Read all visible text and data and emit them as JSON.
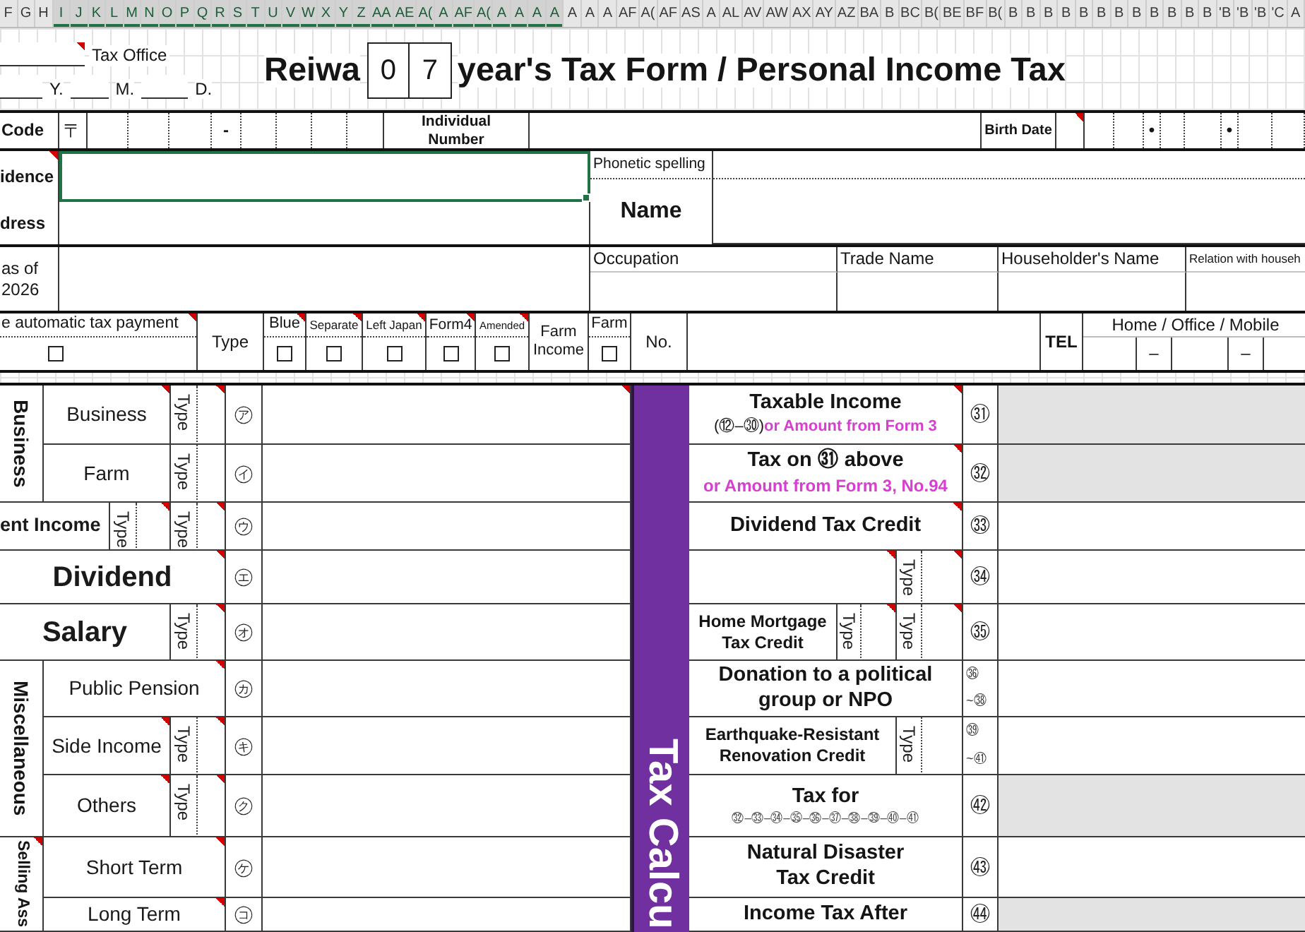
{
  "column_headers": [
    {
      "label": "F",
      "selected": false
    },
    {
      "label": "G",
      "selected": false
    },
    {
      "label": "H",
      "selected": false
    },
    {
      "label": "I",
      "selected": true
    },
    {
      "label": "J",
      "selected": true
    },
    {
      "label": "K",
      "selected": true
    },
    {
      "label": "L",
      "selected": true
    },
    {
      "label": "M",
      "selected": true
    },
    {
      "label": "N",
      "selected": true
    },
    {
      "label": "O",
      "selected": true
    },
    {
      "label": "P",
      "selected": true
    },
    {
      "label": "Q",
      "selected": true
    },
    {
      "label": "R",
      "selected": true
    },
    {
      "label": "S",
      "selected": true
    },
    {
      "label": "T",
      "selected": true
    },
    {
      "label": "U",
      "selected": true
    },
    {
      "label": "V",
      "selected": true
    },
    {
      "label": "W",
      "selected": true
    },
    {
      "label": "X",
      "selected": true
    },
    {
      "label": "Y",
      "selected": true
    },
    {
      "label": "Z",
      "selected": true
    },
    {
      "label": "AA",
      "selected": true
    },
    {
      "label": "AE",
      "selected": true
    },
    {
      "label": "A(",
      "selected": true
    },
    {
      "label": "A",
      "selected": true
    },
    {
      "label": "AF",
      "selected": true
    },
    {
      "label": "A(",
      "selected": true
    },
    {
      "label": "A",
      "selected": true
    },
    {
      "label": "A",
      "selected": true
    },
    {
      "label": "A",
      "selected": true
    },
    {
      "label": "A",
      "selected": true
    },
    {
      "label": "A",
      "selected": false
    },
    {
      "label": "A",
      "selected": false
    },
    {
      "label": "A",
      "selected": false
    },
    {
      "label": "AF",
      "selected": false
    },
    {
      "label": "A(",
      "selected": false
    },
    {
      "label": "AF",
      "selected": false
    },
    {
      "label": "AS",
      "selected": false
    },
    {
      "label": "A",
      "selected": false
    },
    {
      "label": "AL",
      "selected": false
    },
    {
      "label": "AV",
      "selected": false
    },
    {
      "label": "AW",
      "selected": false
    },
    {
      "label": "AX",
      "selected": false
    },
    {
      "label": "AY",
      "selected": false
    },
    {
      "label": "AZ",
      "selected": false
    },
    {
      "label": "BA",
      "selected": false
    },
    {
      "label": "B",
      "selected": false
    },
    {
      "label": "BC",
      "selected": false
    },
    {
      "label": "B(",
      "selected": false
    },
    {
      "label": "BE",
      "selected": false
    },
    {
      "label": "BF",
      "selected": false
    },
    {
      "label": "B(",
      "selected": false
    },
    {
      "label": "B",
      "selected": false
    },
    {
      "label": "B",
      "selected": false
    },
    {
      "label": "B",
      "selected": false
    },
    {
      "label": "B",
      "selected": false
    },
    {
      "label": "B",
      "selected": false
    },
    {
      "label": "B",
      "selected": false
    },
    {
      "label": "B",
      "selected": false
    },
    {
      "label": "B",
      "selected": false
    },
    {
      "label": "B",
      "selected": false
    },
    {
      "label": "B",
      "selected": false
    },
    {
      "label": "B",
      "selected": false
    },
    {
      "label": "B",
      "selected": false
    },
    {
      "label": "'B",
      "selected": false
    },
    {
      "label": "'B",
      "selected": false
    },
    {
      "label": "'B",
      "selected": false
    },
    {
      "label": "'C",
      "selected": false
    },
    {
      "label": "A",
      "selected": false
    }
  ],
  "top": {
    "office": {
      "label": "Tax Office",
      "note": true
    },
    "date_parts": [
      "Y.",
      "M.",
      "D."
    ],
    "title_start": "Reiwa",
    "year_digits": [
      "0",
      "7"
    ],
    "title_end": "year's Tax Form / Personal Income Tax"
  },
  "code_row": {
    "label": "Code",
    "postal_mark": "〒",
    "postal_dash": "-",
    "number_label": "Individual Number",
    "birth_label": "Birth Date",
    "birth_note": true,
    "birth_dots": [
      "•",
      "•"
    ]
  },
  "residence": {
    "labels": [
      "idence",
      "dress"
    ],
    "label_note": true,
    "field_selected": true,
    "phonetic_label": "Phonetic spelling",
    "name_label": "Name"
  },
  "as_of": {
    "lines": [
      "as of",
      "2026"
    ],
    "fields": [
      "Occupation",
      "Trade Name",
      "Householder's Name",
      "Relation with househ"
    ]
  },
  "options": {
    "auto_payment": {
      "label": "e automatic tax payment",
      "checked": false,
      "note": true
    },
    "type_label": "Type",
    "flags": [
      {
        "label": "Blue",
        "checked": false,
        "note": true
      },
      {
        "label": "Separate",
        "checked": false,
        "note": true
      },
      {
        "label": "Left Japan",
        "checked": false,
        "note": true
      },
      {
        "label": "Form4",
        "checked": false,
        "note": true
      },
      {
        "label": "Amended",
        "checked": false,
        "note": true
      }
    ],
    "farm_income_label": "Farm Income",
    "farm": {
      "label": "Farm",
      "checked": false,
      "note": false
    },
    "number_label": "No.",
    "tel_label": "TEL",
    "phone_label": "Home / Office / Mobile",
    "phone_dashes": [
      "–",
      "–"
    ]
  },
  "income": [
    {
      "kind": "group",
      "label": "Business",
      "note": false,
      "rows": [
        {
          "label": "Business",
          "note": true,
          "types": [
            {
              "label": "Type",
              "note": true
            }
          ],
          "mark": "㋐",
          "value_note": true
        },
        {
          "label": "Farm",
          "note": false,
          "types": [
            {
              "label": "Type",
              "note": false
            }
          ],
          "mark": "㋑",
          "value_note": false
        }
      ]
    },
    {
      "kind": "row",
      "label": "ent Income",
      "note": false,
      "types": [
        {
          "label": "Type",
          "note": true
        },
        {
          "label": "Type",
          "note": true
        }
      ],
      "mark": "㋒",
      "value_note": false
    },
    {
      "kind": "row",
      "label": "Dividend",
      "note": true,
      "mark": "㋓",
      "value_note": false
    },
    {
      "kind": "row",
      "label": "Salary",
      "note": false,
      "types": [
        {
          "label": "Type",
          "note": true
        }
      ],
      "mark": "㋔",
      "value_note": false
    },
    {
      "kind": "group",
      "label": "Miscellaneous",
      "note": false,
      "rows": [
        {
          "label": "Public Pension",
          "note": true,
          "mark": "㋕",
          "value_note": false
        },
        {
          "label": "Side Income",
          "note": true,
          "types": [
            {
              "label": "Type",
              "note": true
            }
          ],
          "mark": "㋖",
          "value_note": false
        },
        {
          "label": "Others",
          "note": true,
          "types": [
            {
              "label": "Type",
              "note": true
            }
          ],
          "mark": "㋗",
          "value_note": false
        }
      ]
    },
    {
      "kind": "group",
      "label": "Selling Ass",
      "note": true,
      "rows": [
        {
          "label": "Short Term",
          "note": true,
          "mark": "㋘",
          "value_note": false
        },
        {
          "label": "Long Term",
          "note": true,
          "mark": "㋙",
          "value_note": false
        }
      ]
    }
  ],
  "band": {
    "label": "Tax Calcu"
  },
  "tax_rows": [
    {
      "title": "Taxable Income",
      "formula": "(⑫–㉚)",
      "alt": "or Amount from Form 3",
      "title_note": true,
      "marks": [
        "㉛"
      ],
      "shaded": true
    },
    {
      "title": "Tax on ㉛ above",
      "alt": "or Amount from Form 3, No.94",
      "title_note": true,
      "marks": [
        "㉜"
      ],
      "shaded": true
    },
    {
      "title": "Dividend Tax Credit",
      "title_note": true,
      "marks": [
        "㉝"
      ],
      "shaded": false
    },
    {
      "title_note": true,
      "types": [
        {
          "label": "Type",
          "note": true
        }
      ],
      "marks": [
        "㉞"
      ],
      "shaded": false
    },
    {
      "title": "Home Mortgage Tax Credit",
      "title_note": false,
      "types": [
        {
          "label": "Type",
          "note": true
        },
        {
          "label": "Type",
          "note": true
        }
      ],
      "marks": [
        "㉟"
      ],
      "shaded": false
    },
    {
      "title": "Donation to a political group or NPO",
      "title_note": false,
      "marks": [
        "㊱",
        "~㊳"
      ],
      "shaded": false
    },
    {
      "title": "Earthquake-Resistant Renovation Credit",
      "title_note": false,
      "types": [
        {
          "label": "Type",
          "note": false
        }
      ],
      "marks": [
        "㊴",
        "~㊶"
      ],
      "shaded": false
    },
    {
      "title": "Tax for",
      "formula": "㉜–㉝–㉞–㉟–㊱–㊲–㊳–㊴–㊵–㊶",
      "title_note": false,
      "marks": [
        "㊷"
      ],
      "shaded": true
    },
    {
      "title": "Natural Disaster Tax Credit",
      "title_note": false,
      "marks": [
        "㊸"
      ],
      "shaded": false
    },
    {
      "title": "Income Tax After",
      "title_note": false,
      "marks": [
        "㊹"
      ],
      "shaded": true
    }
  ]
}
